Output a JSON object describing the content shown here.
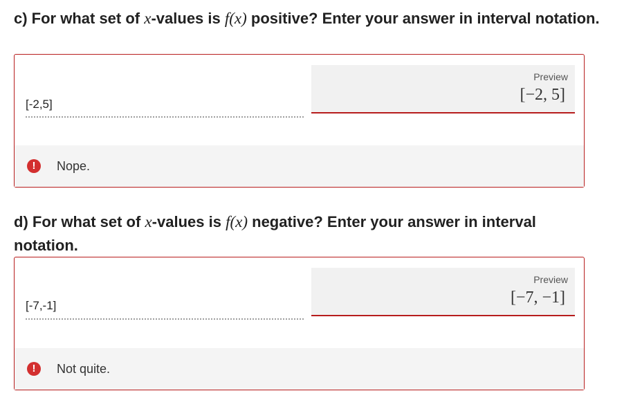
{
  "questions": [
    {
      "title_before": "c) For what set of ",
      "title_var": "x",
      "title_mid": "-values is ",
      "title_func": "f",
      "title_arg_open": "(",
      "title_arg": "x",
      "title_arg_close": ")",
      "title_after": " positive? Enter your answer in interval notation.",
      "answer_value": "[-2,5]",
      "preview_label": "Preview",
      "preview_math": "[−2, 5]",
      "feedback_icon": "!",
      "feedback_text": "Nope."
    },
    {
      "title_before": "d) For what set of ",
      "title_var": "x",
      "title_mid": "-values is ",
      "title_func": "f",
      "title_arg_open": "(",
      "title_arg": "x",
      "title_arg_close": ")",
      "title_after": " negative? Enter your answer in interval notation.",
      "answer_value": "[-7,-1]",
      "preview_label": "Preview",
      "preview_math": "[−7, −1]",
      "feedback_icon": "!",
      "feedback_text": "Not quite."
    }
  ],
  "colors": {
    "error_border": "#b71c1c",
    "error_icon": "#d32f2f",
    "feedback_bg": "#f4f4f4",
    "preview_bg": "#f1f1f1"
  },
  "icons": {
    "feedback": "exclamation-circle-icon"
  }
}
